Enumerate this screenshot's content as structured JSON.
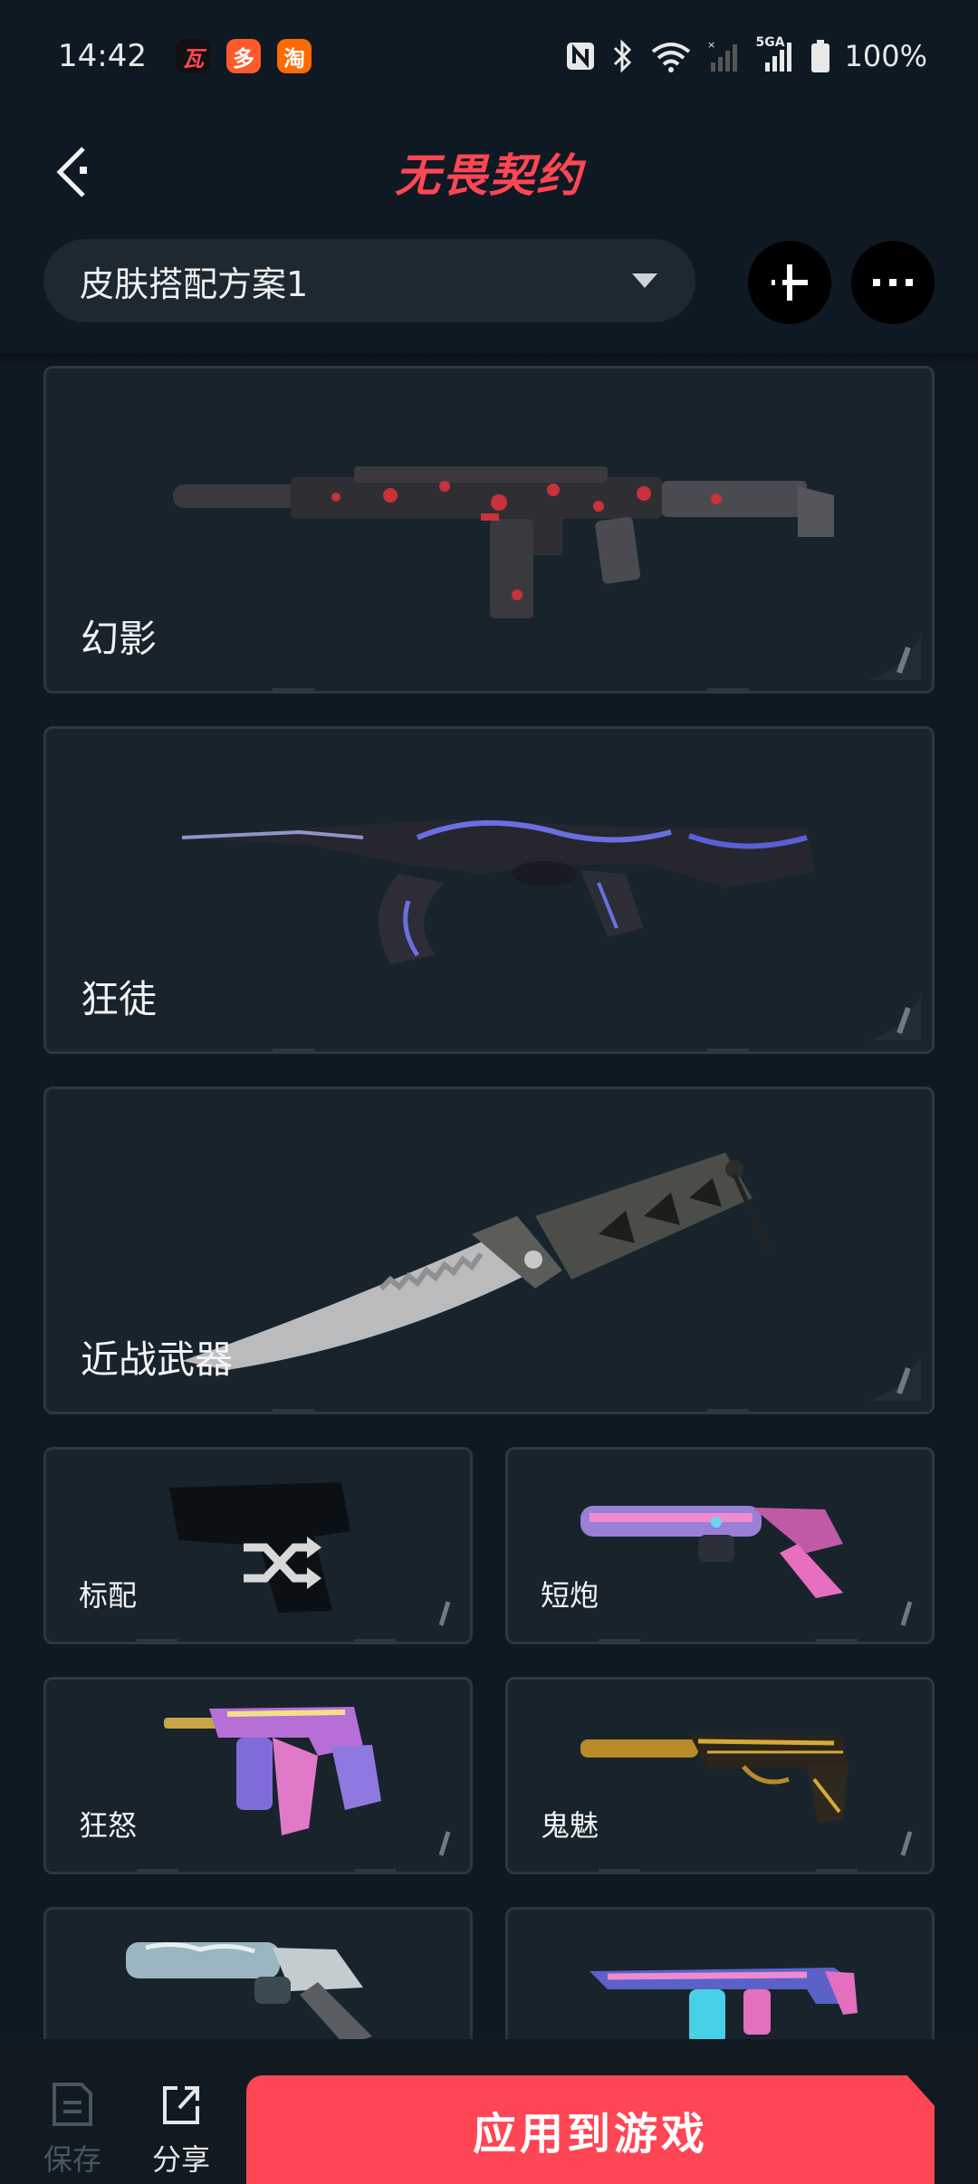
{
  "status": {
    "time": "14:42",
    "apps": [
      "瓦",
      "多",
      "淘"
    ],
    "network": "5GA",
    "battery": "100%"
  },
  "header": {
    "title": "无畏契约",
    "loadout_name": "皮肤搭配方案1"
  },
  "weapons": {
    "primary": "幻影",
    "secondary": "狂徒",
    "melee": "近战武器",
    "grid": [
      {
        "name": "标配"
      },
      {
        "name": "短炮"
      },
      {
        "name": "狂怒"
      },
      {
        "name": "鬼魅"
      },
      {
        "name": ""
      },
      {
        "name": ""
      }
    ]
  },
  "bottom": {
    "save_label": "保存",
    "share_label": "分享",
    "apply_label": "应用到游戏"
  },
  "colors": {
    "accent": "#ff4655",
    "background": "#0f1923",
    "card": "#18232c"
  }
}
